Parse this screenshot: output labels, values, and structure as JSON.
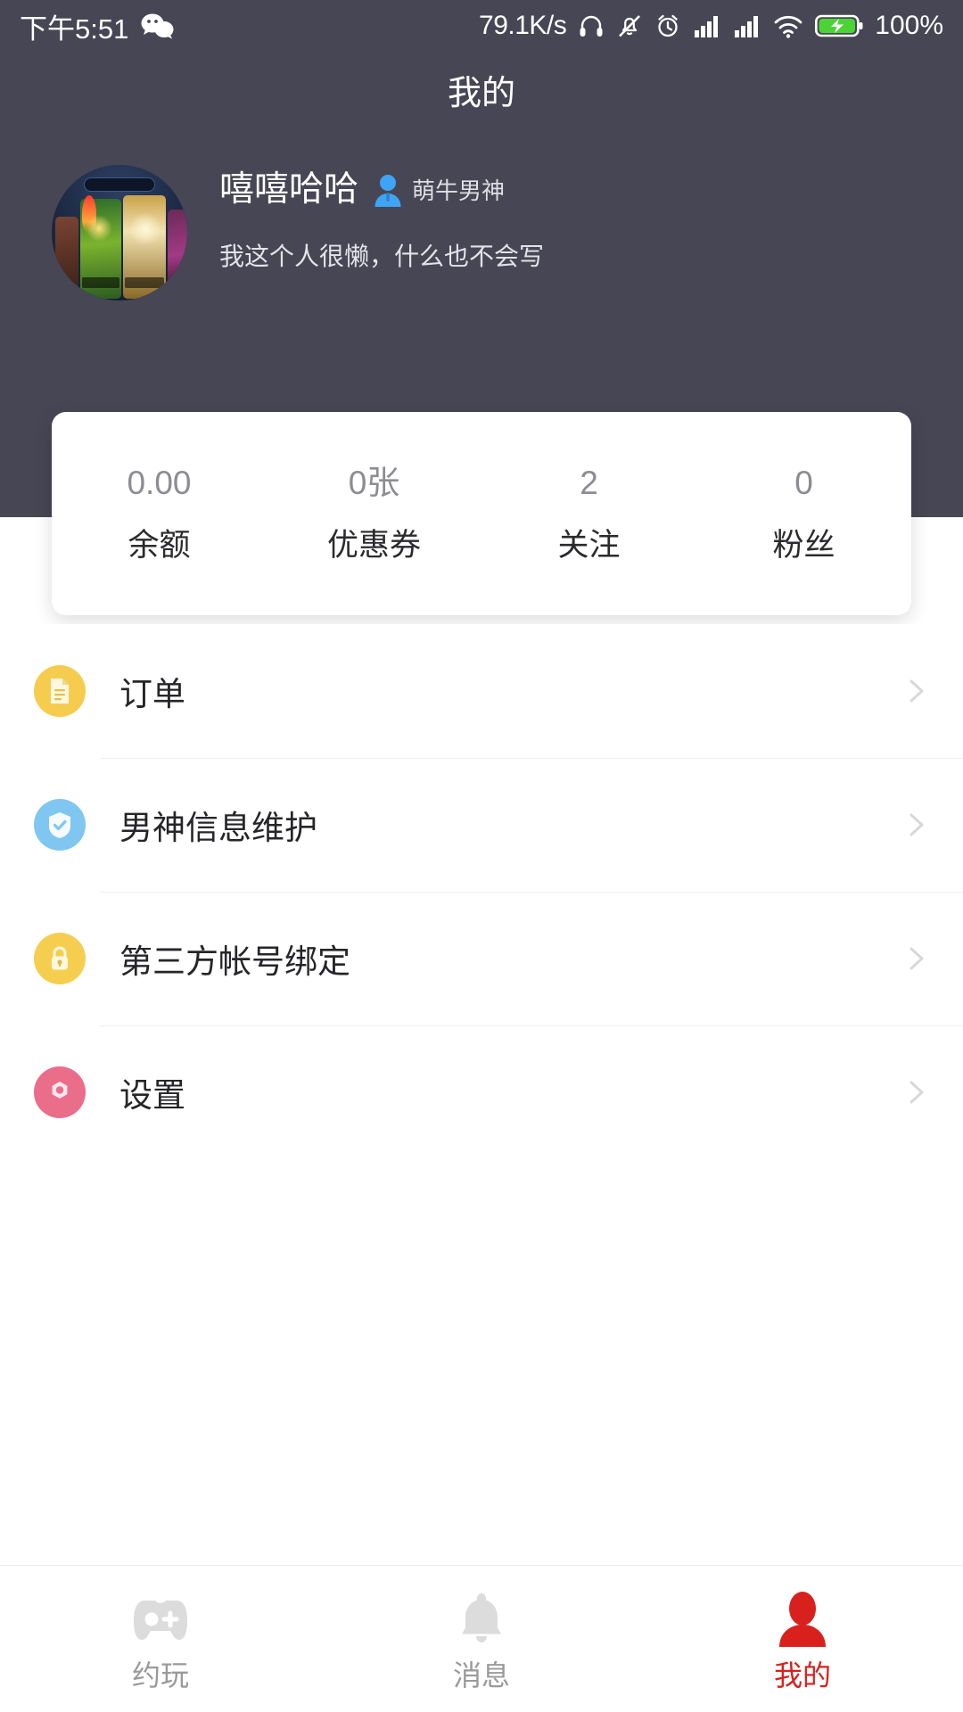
{
  "statusbar": {
    "time": "下午5:51",
    "wechat_icon": "wechat-icon",
    "net_speed": "79.1K/s",
    "headphone_icon": "headphone-icon",
    "mute_icon": "bell-mute-icon",
    "alarm_icon": "alarm-clock-icon",
    "signal1_icon": "signal-bars-icon",
    "signal2_icon": "signal-bars-icon",
    "wifi_icon": "wifi-icon",
    "battery_icon": "battery-charging-icon",
    "battery_pct": "100%"
  },
  "header": {
    "title": "我的",
    "bg_color": "#474654",
    "avatar_icon": "user-avatar-image",
    "username": "嘻嘻哈哈",
    "badge_icon": "user-silhouette-icon",
    "badge_label": "萌牛男神",
    "bio": "我这个人很懒，什么也不会写"
  },
  "stats": [
    {
      "value": "0.00",
      "label": "余额"
    },
    {
      "value": "0张",
      "label": "优惠券"
    },
    {
      "value": "2",
      "label": "关注"
    },
    {
      "value": "0",
      "label": "粉丝"
    }
  ],
  "menu": [
    {
      "label": "订单",
      "icon": "document-icon",
      "icon_color": "#f5cc4d",
      "chevron": "chevron-right-icon"
    },
    {
      "label": "男神信息维护",
      "icon": "shield-check-icon",
      "icon_color": "#7fc7f0",
      "chevron": "chevron-right-icon"
    },
    {
      "label": "第三方帐号绑定",
      "icon": "lock-icon",
      "icon_color": "#f6ce4f",
      "chevron": "chevron-right-icon"
    },
    {
      "label": "设置",
      "icon": "gear-icon",
      "icon_color": "#ea6d8a",
      "chevron": "chevron-right-icon"
    }
  ],
  "tabbar": {
    "active_color": "#d8211d",
    "inactive_color": "#9a9a9a",
    "items": [
      {
        "label": "约玩",
        "icon": "gamepad-icon",
        "active": false
      },
      {
        "label": "消息",
        "icon": "bell-icon",
        "active": false
      },
      {
        "label": "我的",
        "icon": "person-icon",
        "active": true
      }
    ]
  }
}
